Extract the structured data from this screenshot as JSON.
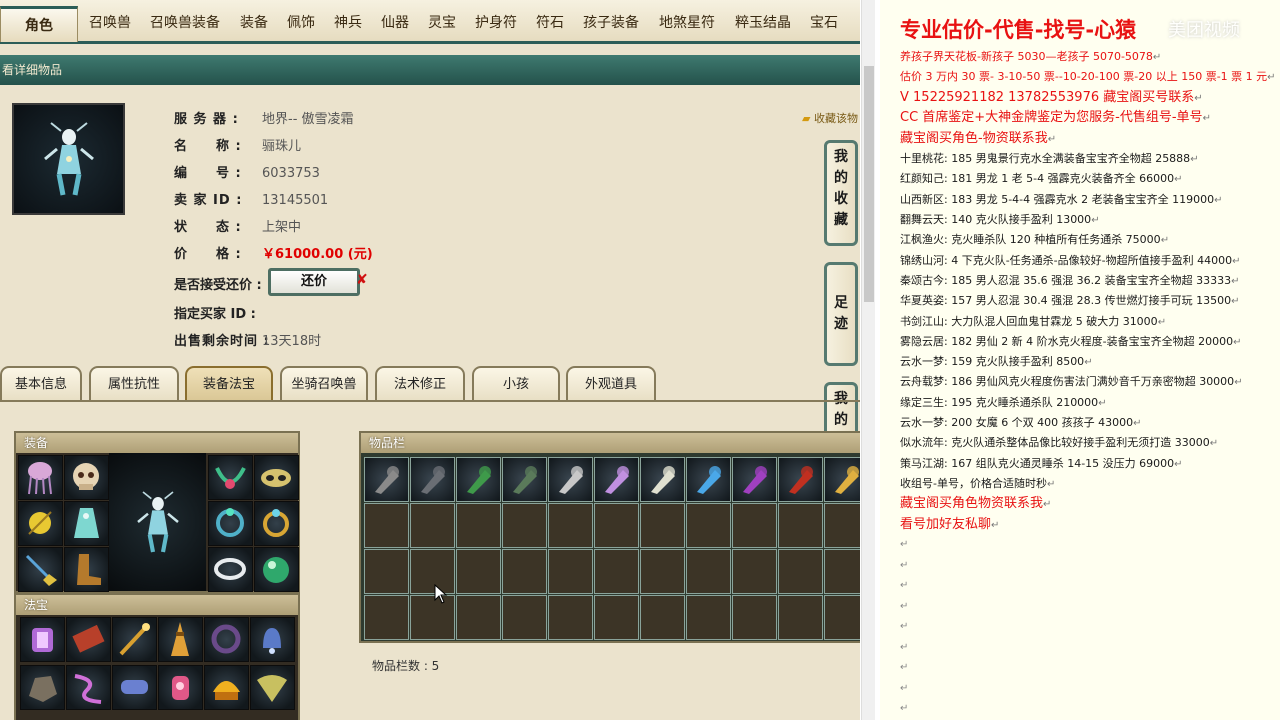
{
  "nav": {
    "active": "角色",
    "tabs": [
      "召唤兽",
      "召唤兽装备",
      "装备",
      "佩饰",
      "神兵",
      "仙器",
      "灵宝",
      "护身符",
      "符石",
      "孩子装备",
      "地煞星符",
      "粹玉结晶",
      "宝石"
    ]
  },
  "title_bar": "看详细物品",
  "item": {
    "server_label": "服 务 器 :",
    "server_value": "地界-- 傲雪凌霜",
    "name_label": "名　　称 :",
    "name_value": "骊珠儿",
    "id_label": "编　　号 :",
    "id_value": "6033753",
    "seller_label": "卖 家 ID :",
    "seller_value": "13145501",
    "status_label": "状　　态 :",
    "status_value": "上架中",
    "price_label": "价　　格 :",
    "price_value": "￥61000.00 (元)",
    "counter_label": "是否接受还价 :",
    "counter_button": "还价",
    "counter_x": "✘",
    "buyer_label": "指定买家 ID :",
    "remain_label": "出售剩余时间 :",
    "remain_value": "13天18时"
  },
  "favorite_link": "收藏该物",
  "side_buttons": [
    "我的收藏",
    "足迹",
    "我的还价"
  ],
  "detail_tabs": [
    "基本信息",
    "属性抗性",
    "装备法宝",
    "坐骑召唤兽",
    "法术修正",
    "小孩",
    "外观道具"
  ],
  "active_detail_tab": "装备法宝",
  "equip_panel": {
    "title": "装备"
  },
  "fabao_panel": {
    "title": "法宝"
  },
  "inventory_panel": {
    "title": "物品栏",
    "count_label": "物品栏数 : 5"
  },
  "icons": {
    "equip_slots": [
      "jellyfish-icon",
      "skull-helmet-icon",
      "jade-necklace-icon",
      "feather-mask-icon",
      "gold-orb-icon",
      "cyan-dress-icon",
      "jade-ring-icon",
      "gold-ring-icon",
      "pendant-icon",
      "boots-icon",
      "silver-bracelet-icon",
      "green-orb-icon"
    ],
    "fabao_slots": [
      "lantern-icon",
      "scroll-icon",
      "staff-icon",
      "tower-icon",
      "dark-ring-icon",
      "rope-icon",
      "rock-icon",
      "whip-icon",
      "fan-icon",
      "lamp-icon",
      "fire-bowl-icon",
      "bell-icon"
    ],
    "inventory_items": [
      "axe-icon",
      "helmet-icon",
      "wreath-icon",
      "robe-icon",
      "battle-axe-icon",
      "purple-flame-icon",
      "cloak-icon",
      "crystal-icon",
      "purple-blade-icon",
      "red-blade-icon",
      "gold-shield-icon"
    ]
  },
  "right_panel": {
    "title": "专业估价-代售-找号-心猿",
    "watermark": "美团视频",
    "lines": [
      {
        "text": "养孩子界天花板-新孩子 5030—老孩子 5070-5078",
        "style": "red"
      },
      {
        "text": "估价 3 万内 30 票- 3-10-50 票--10-20-100 票-20 以上 150 票-1 票 1 元",
        "style": "red"
      },
      {
        "text": "V 15225921182       13782553976    藏宝阁买号联系",
        "style": "redbig"
      },
      {
        "text": "CC 首席鉴定+大神金牌鉴定为您服务-代售组号-单号",
        "style": "redbig"
      },
      {
        "text": "藏宝阁买角色-物资联系我",
        "style": "redbig"
      },
      {
        "text": "十里桃花: 185 男鬼景行克水全满装备宝宝齐全物超 25888",
        "style": "black"
      },
      {
        "text": "红颜知己: 181 男龙 1 老 5-4 强霹克火装备齐全 66000",
        "style": "black"
      },
      {
        "text": "山西新区: 183 男龙 5-4-4 强霹克水 2 老装备宝宝齐全 119000",
        "style": "black"
      },
      {
        "text": "翻舞云天: 140 克火队接手盈利 13000",
        "style": "black"
      },
      {
        "text": "江枫渔火: 克火睡杀队 120 种植所有任务通杀 75000",
        "style": "black"
      },
      {
        "text": "锦绣山河: 4 下克火队-任务通杀-品像较好-物超所值接手盈利 44000",
        "style": "black"
      },
      {
        "text": "秦颂古今: 185 男人忍混 35.6 强混 36.2 装备宝宝齐全物超 33333",
        "style": "black"
      },
      {
        "text": "华夏英姿: 157 男人忍混 30.4 强混 28.3 传世燃灯接手可玩 13500",
        "style": "black"
      },
      {
        "text": "书剑江山: 大力队混人回血鬼甘霖龙 5 破大力 31000",
        "style": "black"
      },
      {
        "text": "雾隐云居: 182 男仙 2 新 4 阶水克火程度-装备宝宝齐全物超 20000",
        "style": "black"
      },
      {
        "text": "云水一梦: 159 克火队接手盈利 8500",
        "style": "black"
      },
      {
        "text": "云舟载梦: 186 男仙风克火程度伤害法门满妙音千万亲密物超 30000",
        "style": "black"
      },
      {
        "text": "缘定三生: 195 克火睡杀通杀队 210000",
        "style": "black"
      },
      {
        "text": "云水一梦: 200 女魔 6 个双 400 孩孩子 43000",
        "style": "black"
      },
      {
        "text": "似水流年: 克火队通杀整体品像比较好接手盈利无须打造 33000",
        "style": "black"
      },
      {
        "text": "策马江湖: 167 组队克火通灵睡杀 14-15 没压力 69000",
        "style": "black"
      },
      {
        "text": "收组号-单号，价格合适随时秒",
        "style": "black"
      },
      {
        "text": "藏宝阁买角色物资联系我",
        "style": "redbig"
      },
      {
        "text": "看号加好友私聊",
        "style": "redbig"
      }
    ],
    "para_mark": "↵"
  }
}
